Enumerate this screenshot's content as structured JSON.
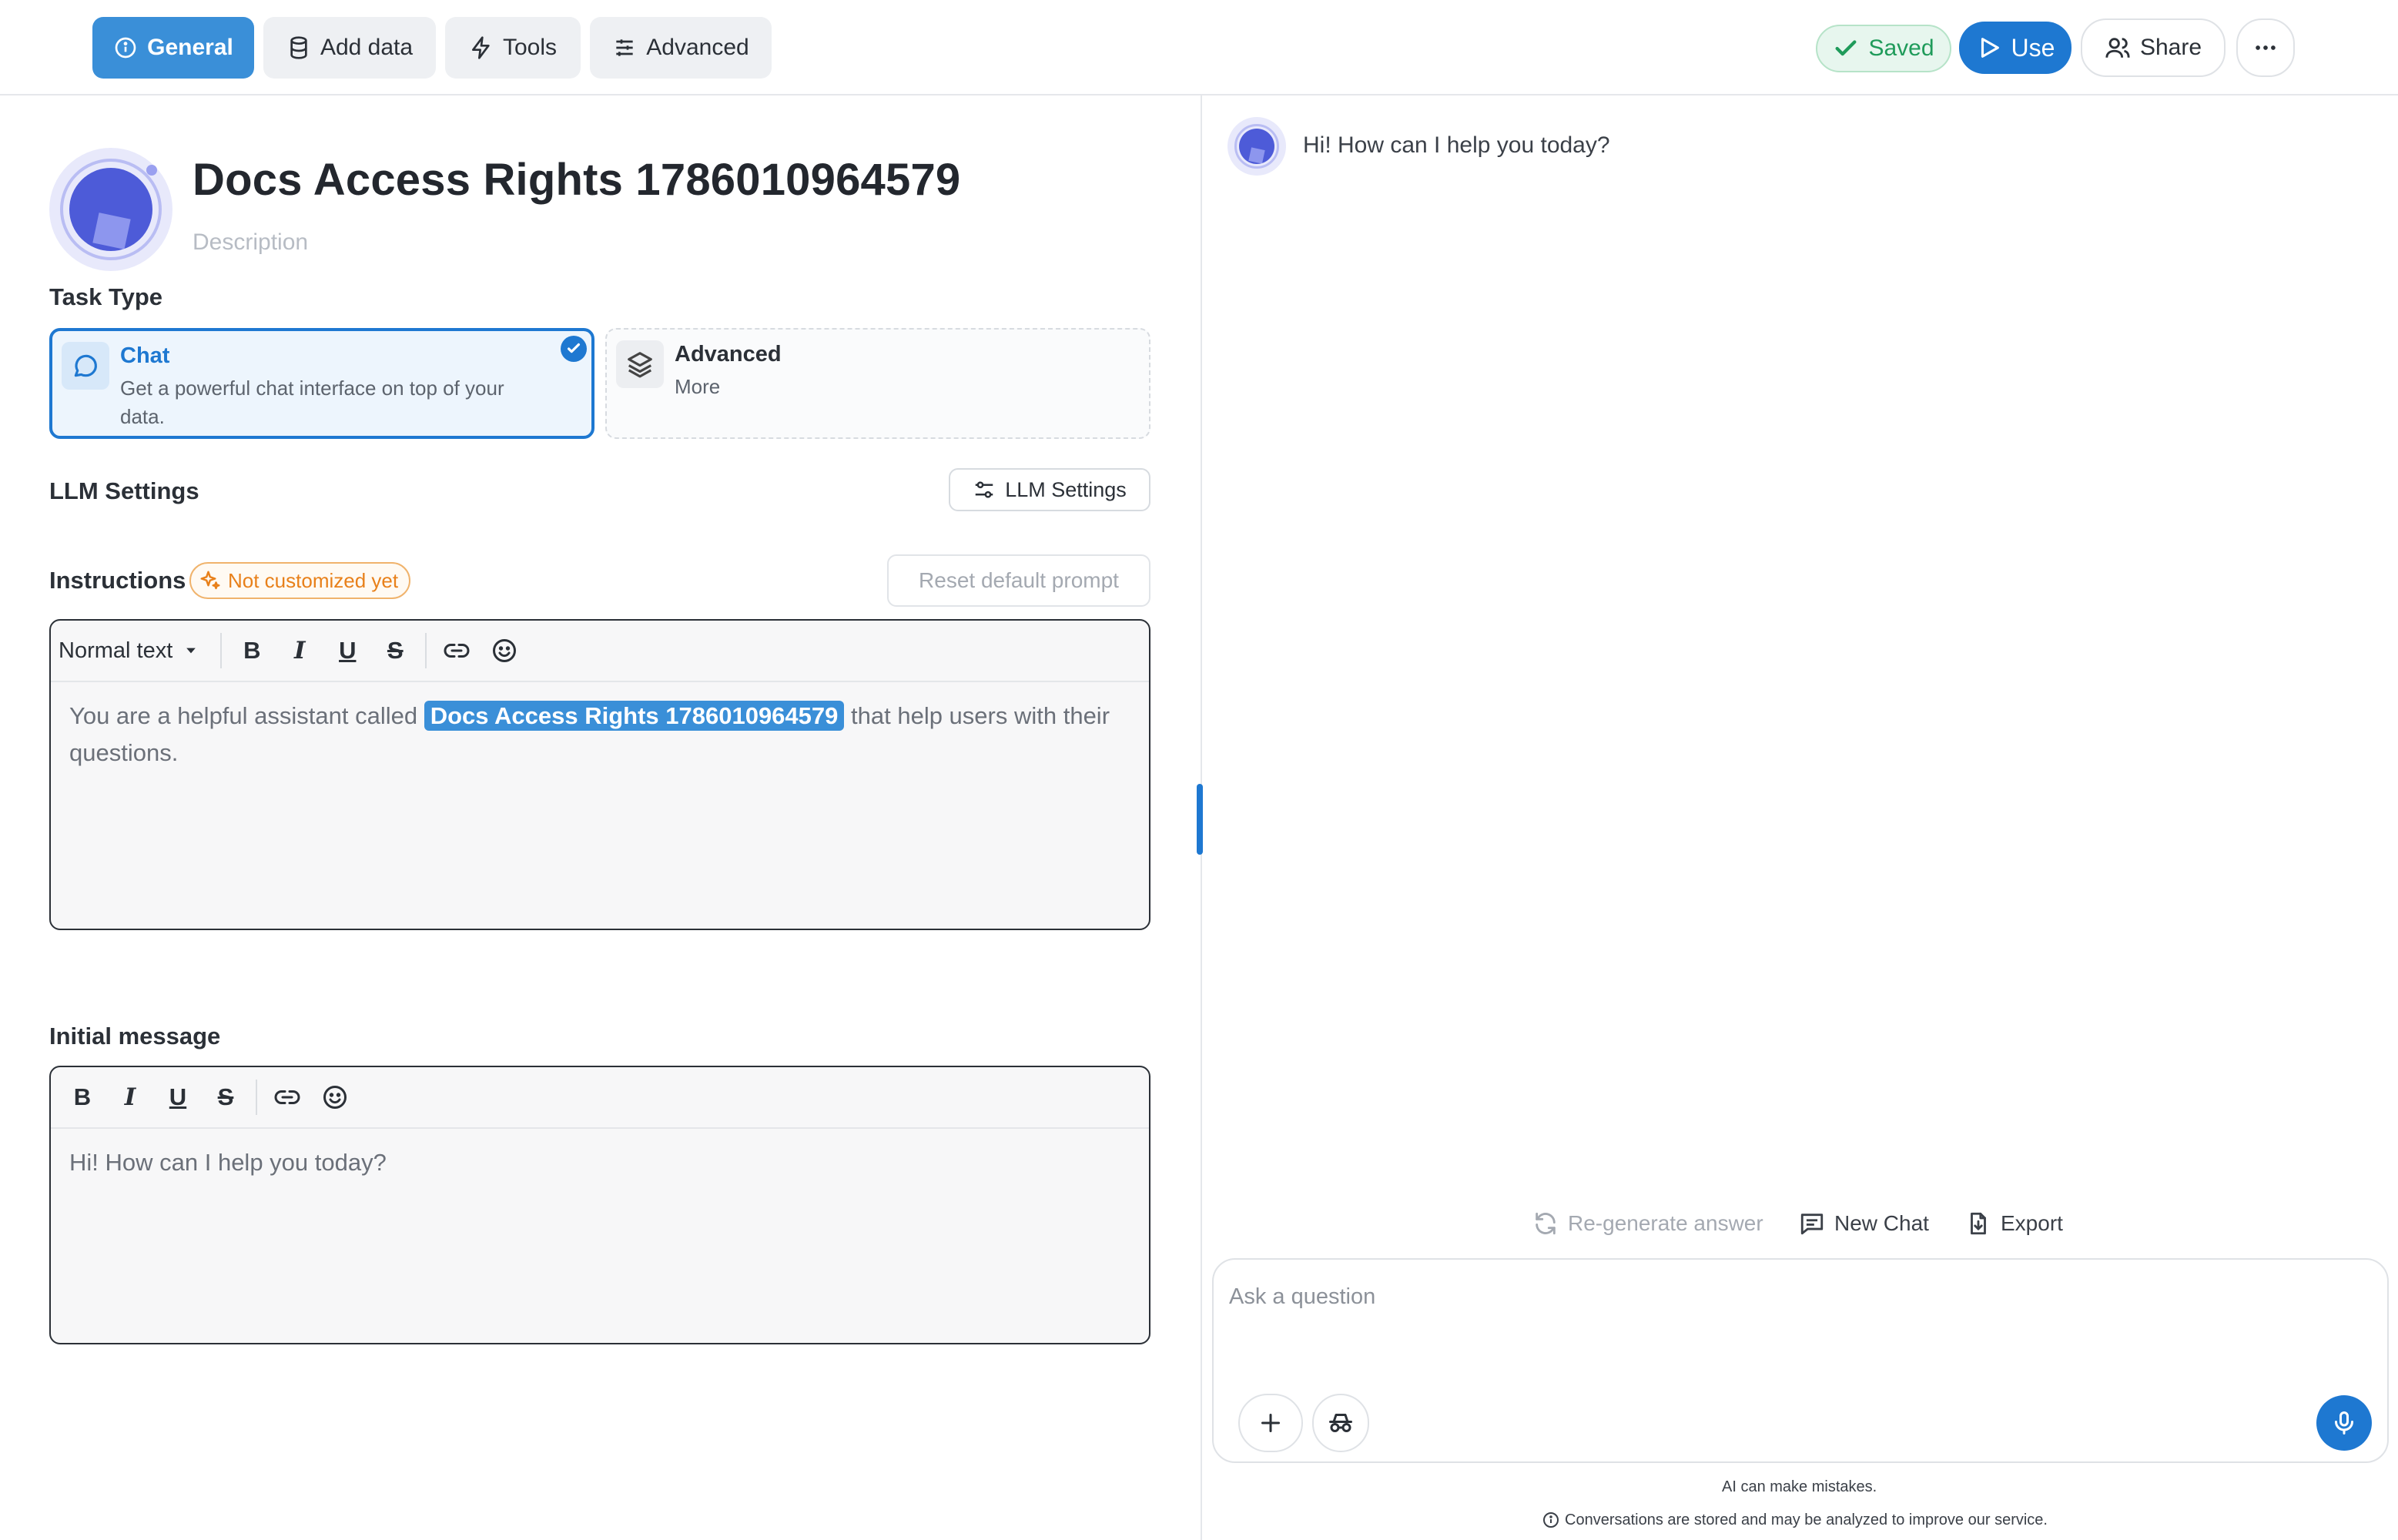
{
  "tabs": [
    {
      "label": "General",
      "icon": "info-icon",
      "active": true
    },
    {
      "label": "Add data",
      "icon": "database-icon",
      "active": false
    },
    {
      "label": "Tools",
      "icon": "bolt-icon",
      "active": false
    },
    {
      "label": "Advanced",
      "icon": "sliders-icon",
      "active": false
    }
  ],
  "header_actions": {
    "saved_label": "Saved",
    "use_label": "Use",
    "share_label": "Share",
    "more_icon": "ellipsis-icon"
  },
  "assistant": {
    "title": "Docs Access Rights 1786010964579",
    "description_placeholder": "Description"
  },
  "task_type": {
    "label": "Task Type",
    "options": [
      {
        "title": "Chat",
        "subtitle": "Get a powerful chat interface on top of your data.",
        "selected": true,
        "icon": "chat-bubble-icon"
      },
      {
        "title": "Advanced",
        "subtitle": "More",
        "selected": false,
        "icon": "layers-icon"
      }
    ]
  },
  "llm_settings": {
    "label": "LLM Settings",
    "button_label": "LLM Settings"
  },
  "instructions": {
    "label": "Instructions",
    "badge": "Not customized yet",
    "reset_label": "Reset default prompt",
    "text_before": "You are a helpful assistant called",
    "highlight": "Docs Access Rights 1786010964579",
    "text_after": "that help users with their questions.",
    "format_select": "Normal text"
  },
  "initial_message": {
    "label": "Initial message",
    "text": "Hi! How can I help you today?"
  },
  "chat": {
    "bot_message": "Hi! How can I help you today?",
    "regenerate_label": "Re-generate answer",
    "new_chat_label": "New Chat",
    "export_label": "Export",
    "input_placeholder": "Ask a question",
    "disclaimer": "AI can make mistakes.",
    "privacy_note": "Conversations are stored and may be analyzed to improve our service."
  },
  "colors": {
    "accent": "#1e78d1",
    "tab_active": "#3a8fd8",
    "saved_green": "#1f9b5a",
    "badge_orange": "#e8801a"
  }
}
